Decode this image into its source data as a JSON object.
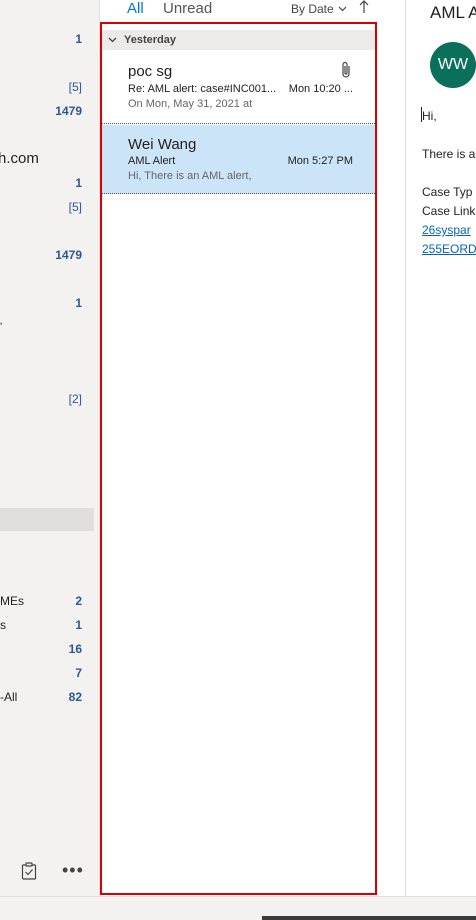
{
  "folders": {
    "account_partial": "h.com",
    "items": [
      {
        "name": "",
        "count": "1",
        "bold": true
      },
      {
        "name": "",
        "count": "[5]",
        "bold": false
      },
      {
        "name": "",
        "count": "1479",
        "bold": true
      },
      {
        "name": "",
        "count": "1",
        "bold": true
      },
      {
        "name": "",
        "count": "[5]",
        "bold": false
      },
      {
        "name": "",
        "count": "1479",
        "bold": true
      },
      {
        "name": "",
        "count": "1",
        "bold": true
      },
      {
        "name": "",
        "count": "[2]",
        "bold": false
      },
      {
        "name": "MEs",
        "count": "2",
        "bold": true
      },
      {
        "name": "s",
        "count": "1",
        "bold": true
      },
      {
        "name": "",
        "count": "16",
        "bold": true
      },
      {
        "name": "",
        "count": "7",
        "bold": true
      },
      {
        "name": "-All",
        "count": "82",
        "bold": true
      }
    ]
  },
  "list_header": {
    "tab_all": "All",
    "tab_unread": "Unread",
    "sort_label": "By Date",
    "sort_chevron": "chevron-down-icon",
    "sort_direction": "arrow-up-icon"
  },
  "message_group": {
    "label": "Yesterday",
    "chevron": "chevron-down-icon"
  },
  "messages": [
    {
      "sender": "poc sg",
      "subject": "Re: AML alert: case#INC001...",
      "time": "Mon 10:20 ...",
      "preview": "On Mon, May 31, 2021 at",
      "has_attachment": true
    },
    {
      "sender": "Wei Wang",
      "subject": "AML Alert",
      "time": "Mon 5:27 PM",
      "preview": "Hi,  There is an AML alert,",
      "selected": true
    }
  ],
  "reading_pane": {
    "subject": "AML A",
    "avatar_initials": "WW",
    "avatar_color": "#0a6f5b",
    "body_line1": "Hi,",
    "body_line2": "There is a",
    "case_type_label": "Case Typ",
    "case_link_label": "Case Link",
    "link_line1": "26syspar",
    "link_line2": "255EORD"
  },
  "colors": {
    "accent": "#0078d4",
    "highlight_border": "#d90000",
    "selected_row": "#cce4f7",
    "count_blue": "#2b5797"
  },
  "bottom_nav": {
    "tasks_icon": "clipboard-check-icon",
    "more_label": "•••"
  }
}
